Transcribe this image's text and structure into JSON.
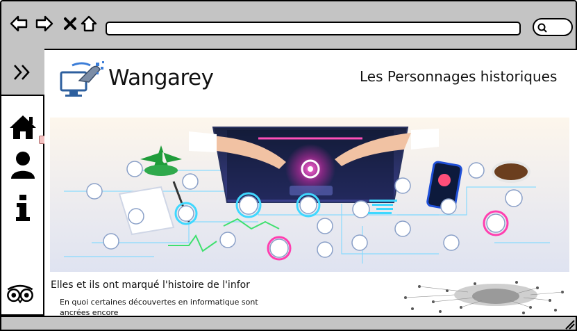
{
  "browser": {
    "icons": [
      "back-arrow-icon",
      "forward-arrow-icon",
      "close-x-icon",
      "home-outline-icon",
      "search-icon"
    ],
    "url": ""
  },
  "sidebar": {
    "items": [
      {
        "name": "expand",
        "icon": "double-chevron-right-icon"
      },
      {
        "name": "home",
        "icon": "home-icon"
      },
      {
        "name": "profile",
        "icon": "user-icon"
      },
      {
        "name": "info",
        "icon": "info-icon"
      },
      {
        "name": "tripadvisor",
        "icon": "owl-icon"
      }
    ]
  },
  "header": {
    "brand": "Wangarey",
    "page_title": "Les Personnages historiques"
  },
  "article": {
    "title": "Elles et ils ont marqué l'histoire de l'infor",
    "subtitle": "En quoi certaines découvertes en informatique sont ancrées encore"
  },
  "colors": {
    "chrome": "#c4c4c4",
    "accent_pink": "#ff3fb0",
    "accent_cyan": "#3fd8ff",
    "hero_bg": "#e9ecf5"
  }
}
